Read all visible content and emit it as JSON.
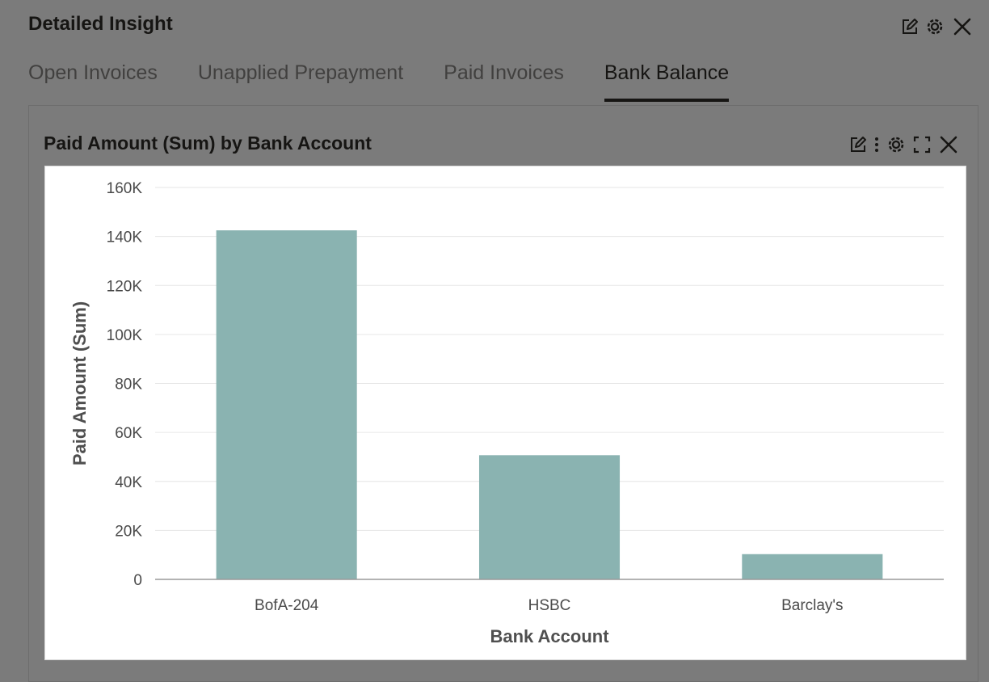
{
  "header": {
    "title": "Detailed Insight",
    "icons": [
      "edit-icon",
      "gear-icon",
      "close-icon"
    ]
  },
  "tabs": [
    {
      "label": "Open Invoices",
      "active": false
    },
    {
      "label": "Unapplied Prepayment",
      "active": false
    },
    {
      "label": "Paid Invoices",
      "active": false
    },
    {
      "label": "Bank Balance",
      "active": true
    }
  ],
  "panel": {
    "title": "Paid Amount (Sum) by Bank Account",
    "icons": [
      "edit-icon",
      "more-vertical-icon",
      "gear-icon",
      "maximize-icon",
      "close-icon"
    ]
  },
  "colors": {
    "bar": "#8ab3b1",
    "grid": "#e6e6e6",
    "axis": "#9a9a9a",
    "background": "#7b7b7b"
  },
  "chart_data": {
    "type": "bar",
    "categories": [
      "BofA-204",
      "HSBC",
      "Barclay's"
    ],
    "values": [
      142500,
      50700,
      10300
    ],
    "xlabel": "Bank Account",
    "ylabel": "Paid Amount (Sum)",
    "ylim": [
      0,
      160000
    ],
    "yticks": [
      0,
      20000,
      40000,
      60000,
      80000,
      100000,
      120000,
      140000,
      160000
    ],
    "ytick_labels": [
      "0",
      "20K",
      "40K",
      "60K",
      "80K",
      "100K",
      "120K",
      "140K",
      "160K"
    ],
    "grid": true,
    "legend": "none"
  }
}
